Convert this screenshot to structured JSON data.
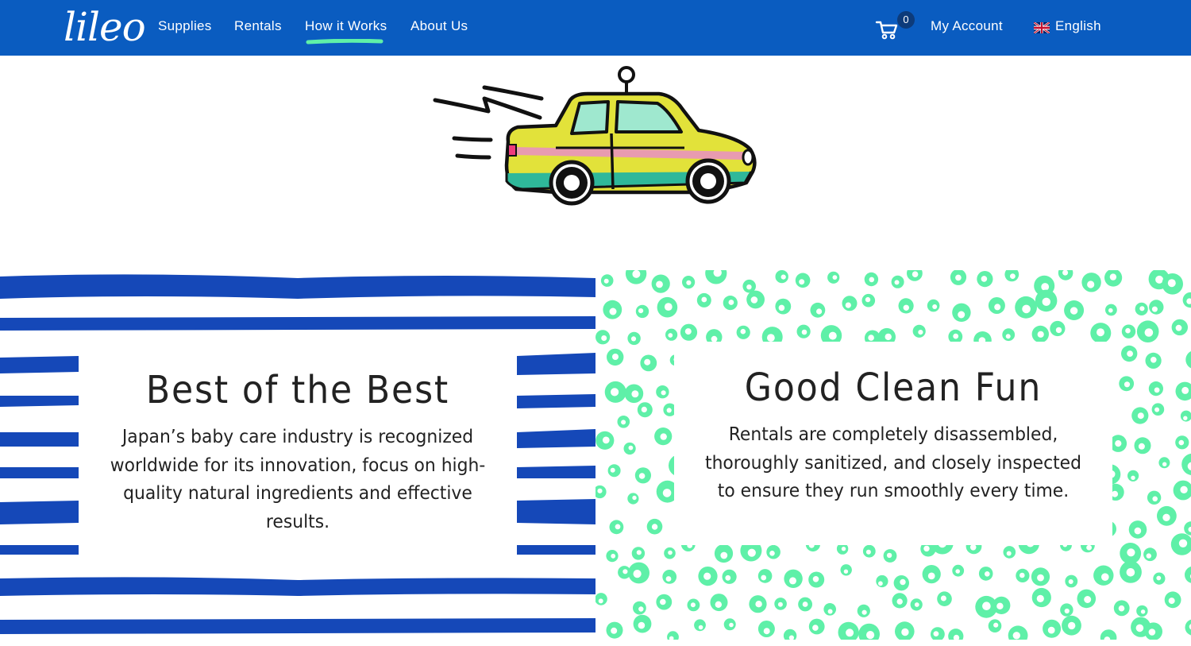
{
  "brand": {
    "logo_text": "lileo",
    "primary_color": "#0a5cc0",
    "accent_color": "#5ff0a8",
    "stripe_color": "#1548b8"
  },
  "nav": {
    "items": [
      {
        "label": "Supplies"
      },
      {
        "label": "Rentals"
      },
      {
        "label": "How it Works",
        "active": true
      },
      {
        "label": "About Us"
      }
    ],
    "cart_count": "0",
    "account_label": "My Account",
    "language_label": "English"
  },
  "hero": {
    "illustration": "taxi-car-illustration"
  },
  "features": [
    {
      "title": "Best of the Best",
      "text": "Japan’s baby care industry is recognized worldwide for its innovation, focus on high-quality natural ingredients and effective results.",
      "pattern": "blue-stripes"
    },
    {
      "title": "Good Clean Fun",
      "text": "Rentals are completely disassembled, thoroughly sanitized, and closely inspected to ensure they run smoothly every time.",
      "pattern": "green-dots"
    }
  ]
}
